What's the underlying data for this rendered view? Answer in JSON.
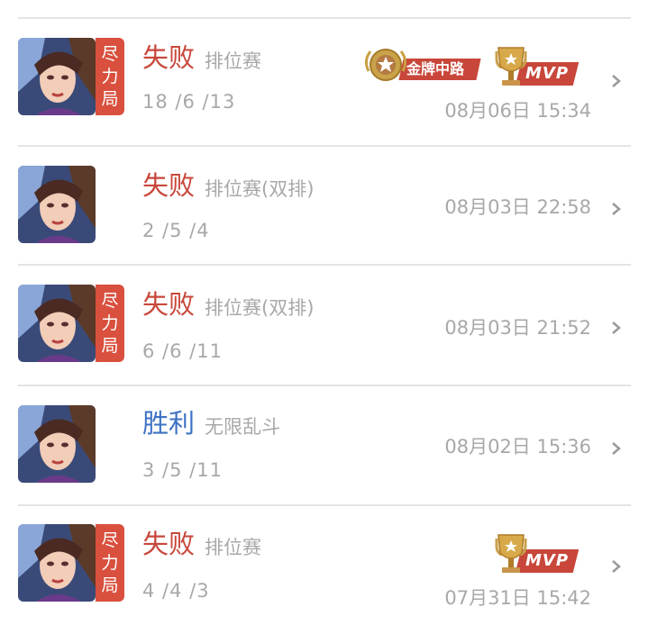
{
  "matches": [
    {
      "result": "失败",
      "result_type": "loss",
      "mode": "排位赛",
      "kda": "18 /6 /13",
      "time": "08月06日 15:34",
      "best_effort_badge": "尽\n力\n局",
      "gold_medal_label": "金牌中路",
      "mvp_label": "MVP"
    },
    {
      "result": "失败",
      "result_type": "loss",
      "mode": "排位赛(双排)",
      "kda": "2 /5 /4",
      "time": "08月03日 22:58"
    },
    {
      "result": "失败",
      "result_type": "loss",
      "mode": "排位赛(双排)",
      "kda": "6 /6 /11",
      "time": "08月03日 21:52",
      "best_effort_badge": "尽\n力\n局"
    },
    {
      "result": "胜利",
      "result_type": "win",
      "mode": "无限乱斗",
      "kda": "3 /5 /11",
      "time": "08月02日 15:36"
    },
    {
      "result": "失败",
      "result_type": "loss",
      "mode": "排位赛",
      "kda": "4 /4 /3",
      "time": "07月31日 15:42",
      "best_effort_badge": "尽\n力\n局",
      "mvp_label": "MVP"
    }
  ],
  "colors": {
    "loss": "#c8473a",
    "win": "#3d72c4",
    "badge": "#d9503e",
    "muted": "#a8a8a8",
    "divider": "#e4e4e4"
  },
  "icons": {
    "chevron": "chevron-right-icon",
    "gold_medal": "gold-medal-icon",
    "mvp_trophy": "mvp-trophy-icon"
  }
}
